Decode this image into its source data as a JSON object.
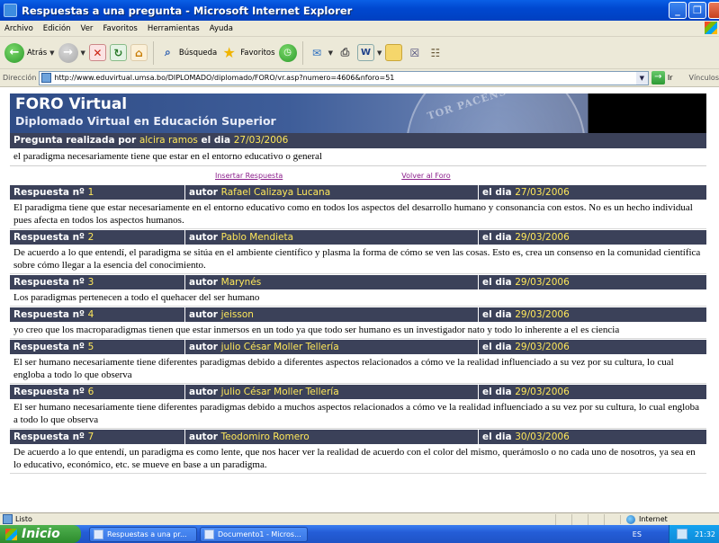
{
  "window": {
    "title": "Respuestas a una pregunta - Microsoft Internet Explorer",
    "buttons": [
      "_",
      "❐",
      "×"
    ]
  },
  "menu": {
    "items": [
      "Archivo",
      "Edición",
      "Ver",
      "Favoritos",
      "Herramientas",
      "Ayuda"
    ]
  },
  "toolbar": {
    "back_label": "Atrás",
    "search_label": "Búsqueda",
    "favorites_label": "Favoritos"
  },
  "address": {
    "label": "Dirección",
    "url": "http://www.eduvirtual.umsa.bo/DIPLOMADO/diplomado/FORO/vr.asp?numero=4606&nforo=51",
    "go_label": "Ir",
    "links_label": "Vínculos"
  },
  "banner": {
    "title": "FORO Virtual",
    "subtitle": "Diplomado Virtual en Educación Superior",
    "seal_text": "TOR PACENS"
  },
  "question": {
    "prefix": "Pregunta realizada por",
    "author": "alcira ramos",
    "date_prefix": "el dia",
    "date": "27/03/2006",
    "text": "el paradigma necesariamente tiene que estar en el entorno educativo o general"
  },
  "links": {
    "insert": "Insertar Respuesta",
    "back": "Volver al Foro"
  },
  "labels": {
    "response": "Respuesta nº",
    "author": "autor",
    "date": "el dia"
  },
  "responses": [
    {
      "num": "1",
      "author": "Rafael Calizaya Lucana",
      "date": "27/03/2006",
      "text": "El paradigma tiene que estar necesariamente en el entorno educativo como en todos los aspectos del desarrollo humano y consonancia con estos. No es un hecho individual pues afecta en todos los aspectos humanos."
    },
    {
      "num": "2",
      "author": "Pablo Mendieta",
      "date": "29/03/2006",
      "text": "De acuerdo a lo que entendí, el paradigma se sitúa en el ambiente científico y plasma la forma de cómo se ven las cosas. Esto es, crea un consenso en la comunidad científica sobre cómo llegar a la esencia del conocimiento."
    },
    {
      "num": "3",
      "author": "Marynés",
      "date": "29/03/2006",
      "text": "Los paradigmas pertenecen a todo el quehacer del ser humano"
    },
    {
      "num": "4",
      "author": "jeisson",
      "date": "29/03/2006",
      "text": "yo creo que los macroparadigmas tienen que estar inmersos en un todo ya que todo ser humano es un investigador nato y todo lo inherente a el es ciencia"
    },
    {
      "num": "5",
      "author": "julio César Moller Tellería",
      "date": "29/03/2006",
      "text": "El ser humano necesariamente tiene diferentes paradigmas debido a diferentes aspectos relacionados a cómo ve la realidad influenciado a su vez por su cultura, lo cual engloba a todo lo que observa"
    },
    {
      "num": "6",
      "author": "julio César Moller Tellería",
      "date": "29/03/2006",
      "text": "El ser humano necesariamente tiene diferentes paradigmas debido a muchos aspectos relacionados a cómo ve la realidad influenciado a su vez por su cultura, lo cual engloba a todo lo que observa"
    },
    {
      "num": "7",
      "author": "Teodomiro Romero",
      "date": "30/03/2006",
      "text": "De acuerdo a lo que entendí, un paradigma es como lente, que nos hacer ver la realidad de acuerdo con el color del mismo, querámoslo o no cada uno de nosotros, ya sea en lo educativo, económico, etc. se mueve en base a un paradigma."
    }
  ],
  "status": {
    "text": "Listo",
    "zone": "Internet"
  },
  "taskbar": {
    "start": "Inicio",
    "tasks": [
      "Respuestas a una pr...",
      "Documento1 - Micros..."
    ],
    "lang": "ES",
    "clock": "21:32"
  }
}
